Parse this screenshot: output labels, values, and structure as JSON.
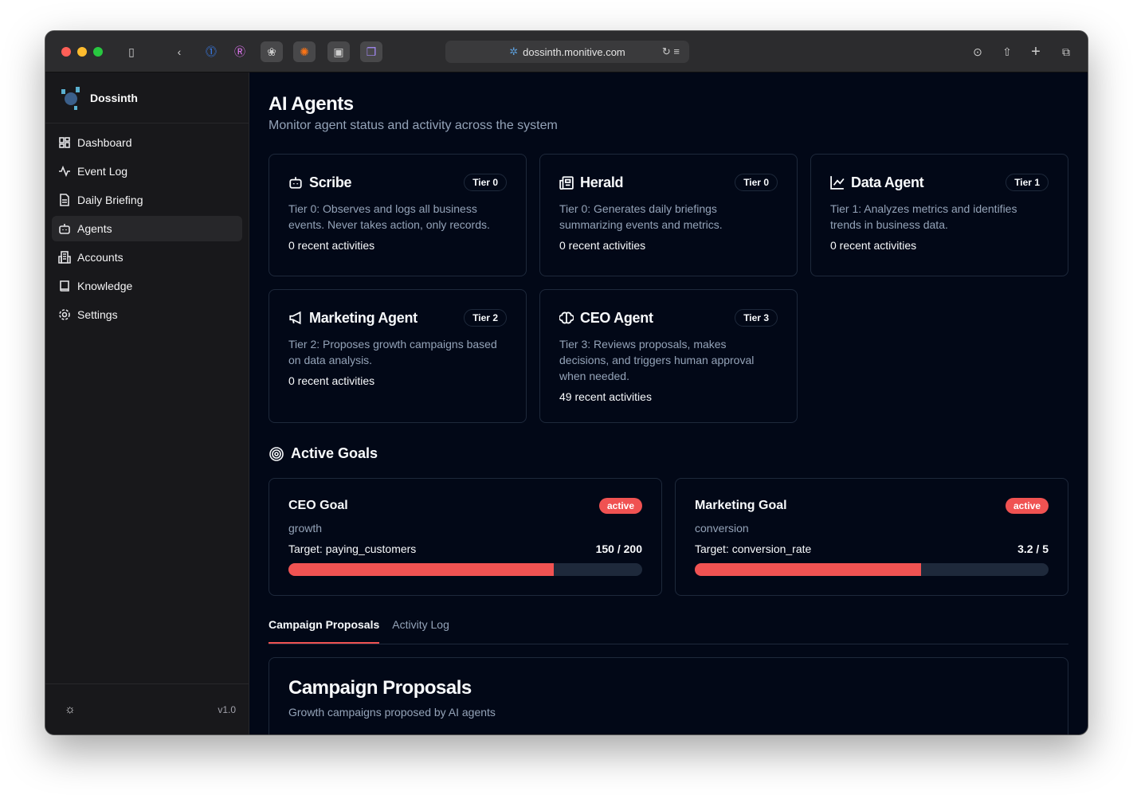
{
  "browser": {
    "url": "dossinth.monitive.com"
  },
  "app": {
    "name": "Dossinth",
    "version": "v1.0"
  },
  "sidebar": {
    "items": [
      {
        "label": "Dashboard",
        "icon": "grid-icon"
      },
      {
        "label": "Event Log",
        "icon": "activity-icon"
      },
      {
        "label": "Daily Briefing",
        "icon": "file-icon"
      },
      {
        "label": "Agents",
        "icon": "bot-icon",
        "active": true
      },
      {
        "label": "Accounts",
        "icon": "building-icon"
      },
      {
        "label": "Knowledge",
        "icon": "book-icon"
      },
      {
        "label": "Settings",
        "icon": "gear-icon"
      }
    ]
  },
  "page": {
    "title": "AI Agents",
    "subtitle": "Monitor agent status and activity across the system"
  },
  "agents": [
    {
      "name": "Scribe",
      "tier": "Tier 0",
      "desc": "Tier 0: Observes and logs all business events. Never takes action, only records.",
      "count": "0 recent activities",
      "icon": "bot-icon"
    },
    {
      "name": "Herald",
      "tier": "Tier 0",
      "desc": "Tier 0: Generates daily briefings summarizing events and metrics.",
      "count": "0 recent activities",
      "icon": "newspaper-icon"
    },
    {
      "name": "Data Agent",
      "tier": "Tier 1",
      "desc": "Tier 1: Analyzes metrics and identifies trends in business data.",
      "count": "0 recent activities",
      "icon": "line-chart-icon"
    },
    {
      "name": "Marketing Agent",
      "tier": "Tier 2",
      "desc": "Tier 2: Proposes growth campaigns based on data analysis.",
      "count": "0 recent activities",
      "icon": "megaphone-icon"
    },
    {
      "name": "CEO Agent",
      "tier": "Tier 3",
      "desc": "Tier 3: Reviews proposals, makes decisions, and triggers human approval when needed.",
      "count": "49 recent activities",
      "icon": "brain-icon"
    }
  ],
  "goals_section": {
    "title": "Active Goals"
  },
  "goals": [
    {
      "name": "CEO Goal",
      "status": "active",
      "category": "growth",
      "target": "Target: paying_customers",
      "progress": "150 / 200",
      "fraction": 0.75
    },
    {
      "name": "Marketing Goal",
      "status": "active",
      "category": "conversion",
      "target": "Target: conversion_rate",
      "progress": "3.2 / 5",
      "fraction": 0.64
    }
  ],
  "tabs": [
    {
      "label": "Campaign Proposals",
      "active": true
    },
    {
      "label": "Activity Log"
    }
  ],
  "proposals": {
    "title": "Campaign Proposals",
    "subtitle": "Growth campaigns proposed by AI agents"
  },
  "colors": {
    "accent": "#f05252",
    "background": "#020817",
    "sidebar": "#18181b"
  }
}
